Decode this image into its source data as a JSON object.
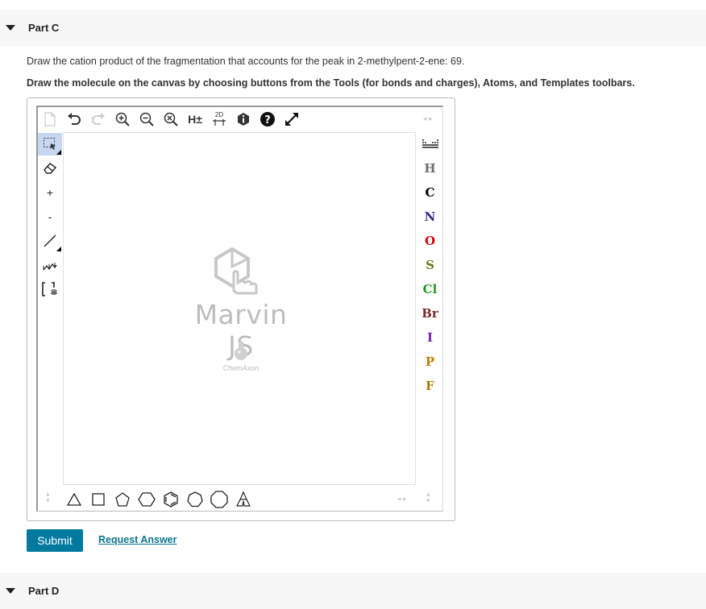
{
  "partC": {
    "title": "Part C"
  },
  "partD": {
    "title": "Part D"
  },
  "question": {
    "prompt": "Draw the cation product of the fragmentation that accounts for the peak in 2-methylpent-2-ene: 69.",
    "instruction": "Draw the molecule on the canvas by choosing buttons from the Tools (for bonds and charges), Atoms, and Templates toolbars."
  },
  "editor": {
    "logo_name": "Marvin JS",
    "logo_sub": "ChemAxon",
    "top_toolbar": {
      "h_label": "H±",
      "clean_label": "2D"
    },
    "left_toolbar": {
      "plus_label": "+",
      "minus_label": "-"
    },
    "atoms": [
      {
        "symbol": "H",
        "color": "#6b6b6b"
      },
      {
        "symbol": "C",
        "color": "#000000"
      },
      {
        "symbol": "N",
        "color": "#2d2d8c"
      },
      {
        "symbol": "O",
        "color": "#e00000"
      },
      {
        "symbol": "S",
        "color": "#6b7d1a"
      },
      {
        "symbol": "Cl",
        "color": "#1f9a1f"
      },
      {
        "symbol": "Br",
        "color": "#7a2c2c"
      },
      {
        "symbol": "I",
        "color": "#7a1fa8"
      },
      {
        "symbol": "P",
        "color": "#c47a00"
      },
      {
        "symbol": "F",
        "color": "#a67c00"
      }
    ]
  },
  "actions": {
    "submit_label": "Submit",
    "request_label": "Request Answer"
  },
  "colors": {
    "accent": "#00799e",
    "link": "#0c7490",
    "selected_tool": "#c7d7f2"
  }
}
